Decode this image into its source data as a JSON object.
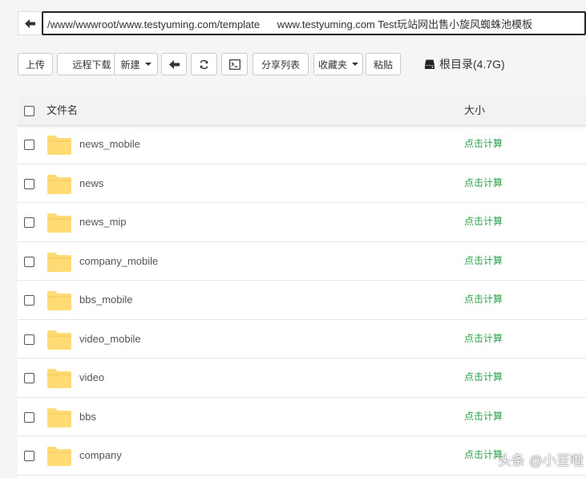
{
  "path_bar": {
    "value": "/www/wwwroot/www.testyuming.com/template      www.testyuming.com Test玩站网出售小旋风蜘蛛池模板"
  },
  "toolbar": {
    "upload": "上传",
    "remote_download": "远程下载",
    "new": "新建",
    "share_list": "分享列表",
    "favorites": "收藏夹",
    "paste": "粘贴",
    "disk_label": "根目录(4.7G)"
  },
  "table": {
    "col_name": "文件名",
    "col_size": "大小",
    "rows": [
      {
        "name": "news_mobile",
        "size": "点击计算"
      },
      {
        "name": "news",
        "size": "点击计算"
      },
      {
        "name": "news_mip",
        "size": "点击计算"
      },
      {
        "name": "company_mobile",
        "size": "点击计算"
      },
      {
        "name": "bbs_mobile",
        "size": "点击计算"
      },
      {
        "name": "video_mobile",
        "size": "点击计算"
      },
      {
        "name": "video",
        "size": "点击计算"
      },
      {
        "name": "bbs",
        "size": "点击计算"
      },
      {
        "name": "company",
        "size": "点击计算"
      }
    ]
  },
  "watermark": "头条 @小豆啦",
  "colors": {
    "folder": "#ffdb76",
    "size_link": "#2aa04a"
  },
  "icons": {
    "back": "arrow-left-icon",
    "refresh": "refresh-icon",
    "terminal": "terminal-icon",
    "disk": "hard-drive-icon",
    "folder": "folder-icon"
  }
}
